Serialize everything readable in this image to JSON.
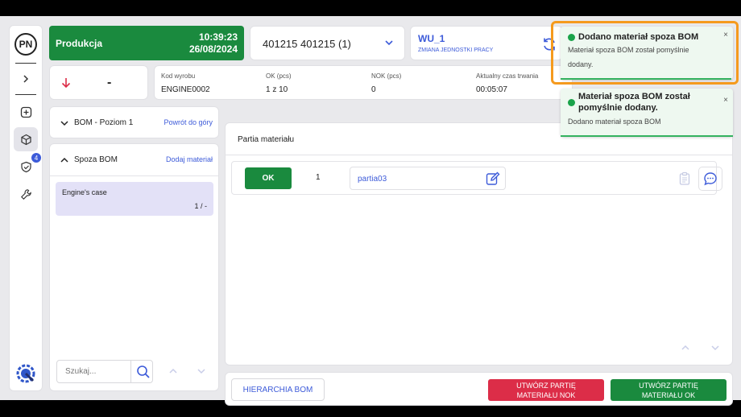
{
  "sidebar": {
    "avatar": "PN",
    "badge": "4"
  },
  "header": {
    "production_label": "Produkcja",
    "time": "10:39:23",
    "date": "26/08/2024",
    "order": "401215 401215  (1)",
    "wu_title": "WU_1",
    "wu_subtitle": "ZMIANA JEDNOSTKI PRACY"
  },
  "status": {
    "value": "-"
  },
  "info": {
    "kod_label": "Kod wyrobu",
    "kod_value": "ENGINE0002",
    "ok_label": "OK (pcs)",
    "ok_value": "1 z 10",
    "nok_label": "NOK (pcs)",
    "nok_value": "0",
    "time_label": "Aktualny czas trwania",
    "time_value": "00:05:07"
  },
  "bom": {
    "title": "BOM - Poziom 1",
    "link": "Powrót do góry"
  },
  "spoza": {
    "title": "Spoza BOM",
    "link": "Dodaj materiał",
    "item_name": "Engine's case",
    "item_qty": "1 / -",
    "search_placeholder": "Szukaj..."
  },
  "batch": {
    "title": "Partia materiału",
    "row": {
      "status": "OK",
      "number": "1",
      "partia": "partia03"
    }
  },
  "footer": {
    "hierarchy": "HIERARCHIA BOM",
    "nok_line1": "UTWÓRZ PARTIĘ",
    "nok_line2": "MATERIAŁU NOK",
    "ok_line1": "UTWÓRZ PARTIĘ",
    "ok_line2": "MATERIAŁU OK"
  },
  "toasts": [
    {
      "title": "Dodano materiał spoza BOM",
      "body1": "Materiał spoza BOM został pomyślnie",
      "body2": "dodany."
    },
    {
      "title1": "Materiał spoza BOM został",
      "title2": "pomyślnie dodany.",
      "body": "Dodano materiał spoza BOM"
    }
  ],
  "colors": {
    "green": "#1a8a3e",
    "blue": "#3d5bd9",
    "red": "#dc2d48",
    "highlight": "#f59a1e"
  }
}
